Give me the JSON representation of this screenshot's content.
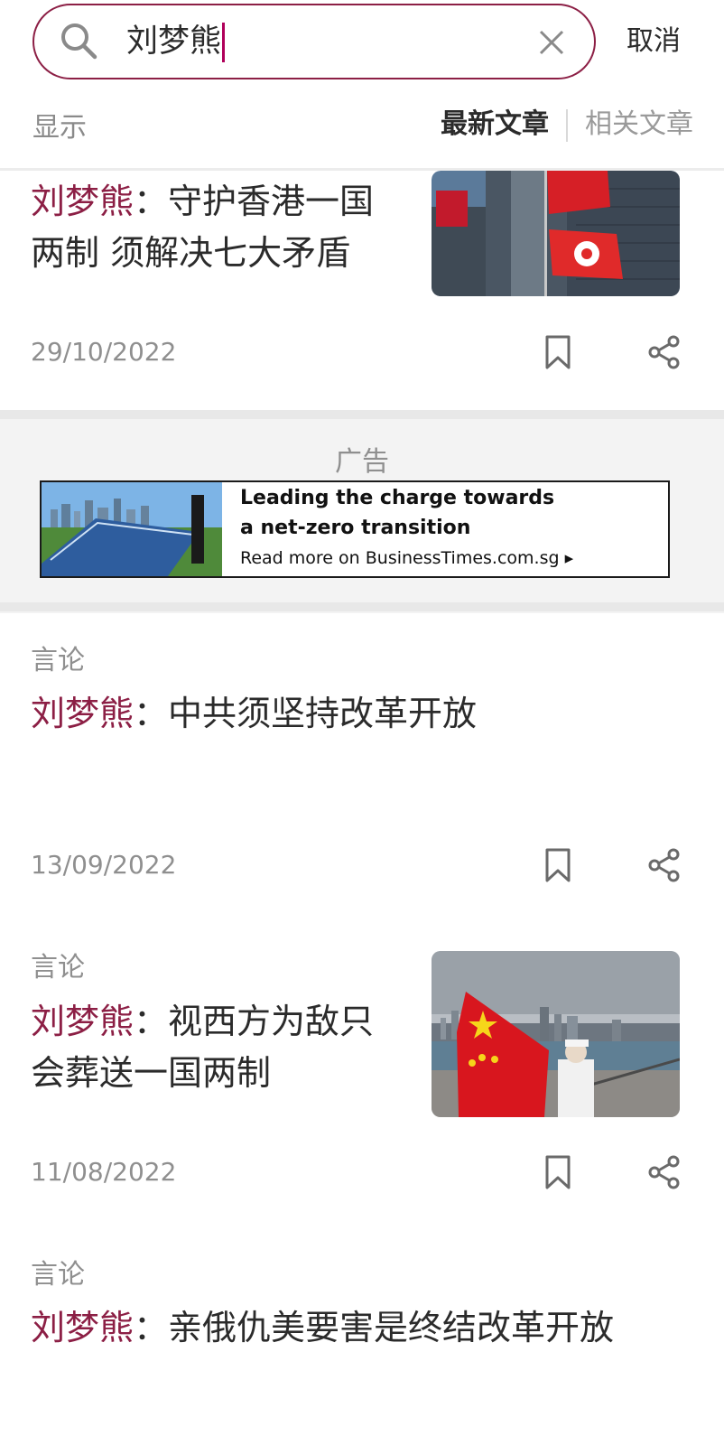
{
  "search": {
    "query": "刘梦熊",
    "cancel_label": "取消"
  },
  "filter": {
    "show_label": "显示",
    "tabs": [
      {
        "label": "最新文章",
        "active": true
      },
      {
        "label": "相关文章",
        "active": false
      }
    ]
  },
  "articles": [
    {
      "highlight": "刘梦熊",
      "title_lines": [
        "：守护香港一国",
        "两制 须解决七大矛盾"
      ],
      "date": "29/10/2022",
      "has_image": true,
      "image": "hong-kong-flags-photo"
    },
    {
      "category": "言论",
      "highlight": "刘梦熊",
      "title_lines": [
        "：中共须坚持改革开放"
      ],
      "date": "13/09/2022",
      "has_image": false
    },
    {
      "category": "言论",
      "highlight": "刘梦熊",
      "title_lines": [
        "：视西方为敌只",
        "会葬送一国两制"
      ],
      "date": "11/08/2022",
      "has_image": true,
      "image": "china-flag-harbour-photo"
    },
    {
      "category": "言论",
      "highlight": "刘梦熊",
      "title_lines": [
        "：亲俄仇美要害是终结改革开放"
      ]
    }
  ],
  "ad": {
    "label": "广告",
    "headline_1": "Leading the charge towards",
    "headline_2": "a net-zero transition",
    "cta": "Read more on BusinessTimes.com.sg ▸"
  },
  "colors": {
    "accent": "#8c1f45",
    "muted": "#8f8f8f"
  },
  "icons": [
    "search-icon",
    "clear-icon",
    "bookmark-icon",
    "share-icon"
  ]
}
